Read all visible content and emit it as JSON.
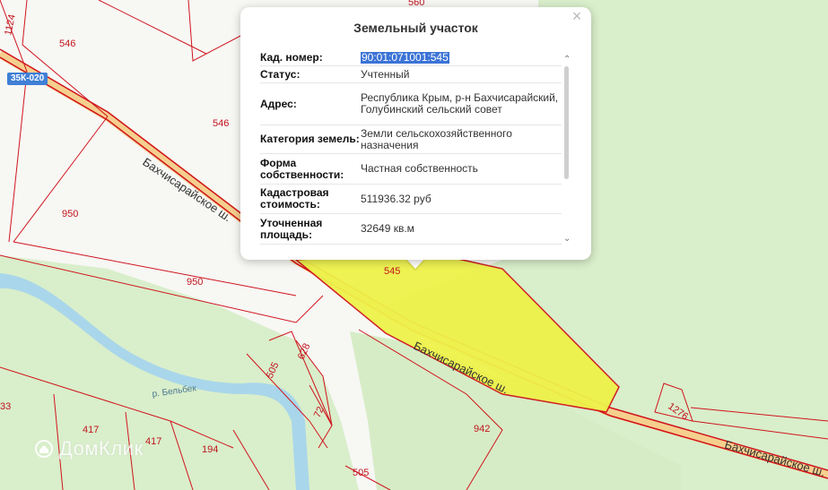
{
  "popup": {
    "title": "Земельный участок",
    "close_glyph": "×",
    "rows": [
      {
        "label": "Кад. номер:",
        "value": "90:01:071001:545"
      },
      {
        "label": "Статус:",
        "value": "Учтенный"
      },
      {
        "label": "Адрес:",
        "value": "Республика Крым, р-н Бахчисарайский, Голубинский сельский совет"
      },
      {
        "label": "Категория земель:",
        "value": "Земли сельскохозяйственного назначения"
      },
      {
        "label": "Форма собственности:",
        "value": "Частная собственность"
      },
      {
        "label": "Кадастровая стоимость:",
        "value": "511936.32 руб"
      },
      {
        "label": "Уточненная площадь:",
        "value": "32649 кв.м"
      }
    ]
  },
  "map": {
    "road_badge": "35К-020",
    "river_name": "р. Бельбек",
    "street_name": "Бахчисарайское ш.",
    "parcel_numbers": [
      "560",
      "1124",
      "546",
      "546",
      "950",
      "950",
      "545",
      "628",
      "505",
      "72",
      "417",
      "417",
      "194",
      "942",
      "1276",
      "505",
      "33"
    ],
    "colors": {
      "parcel_border": "#d0141c",
      "highlight_fill": "#eef24a",
      "forest": "#d9eecb",
      "river": "#a9d6ea",
      "road": "#f5cf8e"
    }
  },
  "watermark": {
    "text": "ДомКлик",
    "icon": "domclick-logo-icon"
  }
}
